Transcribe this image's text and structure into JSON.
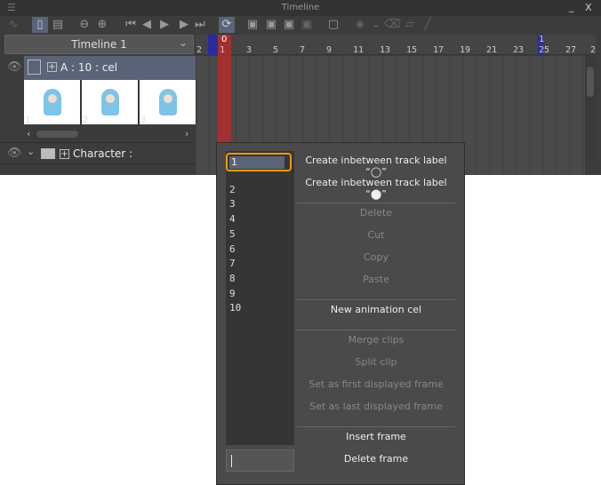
{
  "window": {
    "title": "Timeline",
    "minimize": "_",
    "close": "X",
    "menu": "☰"
  },
  "toolbar": {
    "icons": [
      "graph-icon",
      "frame-view-icon",
      "new-layer-icon",
      "zoom-out-icon",
      "zoom-in-icon",
      "first-frame-icon",
      "prev-frame-icon",
      "play-icon",
      "next-frame-icon",
      "last-frame-icon",
      "loop-icon",
      "new-animation-folder-icon",
      "new-cel-icon",
      "onion-skin-icon",
      "link-icon",
      "frame-display-icon",
      "keyframe-icon",
      "dropdown-icon",
      "delete-cel-icon",
      "lightbox-icon",
      "pen-icon"
    ]
  },
  "timeline_select": {
    "value": "Timeline 1",
    "chevron": "⌄"
  },
  "ruler": {
    "labels": [
      "2",
      "1",
      "3",
      "5",
      "7",
      "9",
      "11",
      "13",
      "15",
      "17",
      "19",
      "21",
      "23",
      "25",
      "27",
      "2"
    ],
    "marker_start": "0",
    "marker_end": "1"
  },
  "track_a": {
    "label": "A : 10 : cel",
    "thumbnails": [
      "1",
      "2",
      "3"
    ]
  },
  "track_character": {
    "label": "Character :"
  },
  "popup": {
    "cels": [
      "1",
      "2",
      "3",
      "4",
      "5",
      "6",
      "7",
      "8",
      "9",
      "10"
    ],
    "selected": "1",
    "input_value": "",
    "menu": [
      {
        "label": "Create inbetween track label “◯”",
        "enabled": true
      },
      {
        "label": "Create inbetween track label “⬤”",
        "enabled": true
      },
      {
        "sep": true
      },
      {
        "label": "Delete",
        "enabled": false
      },
      {
        "label": "Cut",
        "enabled": false
      },
      {
        "label": "Copy",
        "enabled": false
      },
      {
        "label": "Paste",
        "enabled": false
      },
      {
        "sep": true
      },
      {
        "label": "New animation cel",
        "enabled": true
      },
      {
        "sep": true
      },
      {
        "label": "Merge clips",
        "enabled": false
      },
      {
        "label": "Split clip",
        "enabled": false
      },
      {
        "label": "Set as first displayed frame",
        "enabled": false
      },
      {
        "label": "Set as last displayed frame",
        "enabled": false
      },
      {
        "sep": true
      },
      {
        "label": "Insert frame",
        "enabled": true
      },
      {
        "label": "Delete frame",
        "enabled": true
      }
    ]
  },
  "colors": {
    "accent": "#f39a00",
    "selection": "#5a6478",
    "playhead": "#a33030",
    "marker": "#2a2aa0"
  }
}
